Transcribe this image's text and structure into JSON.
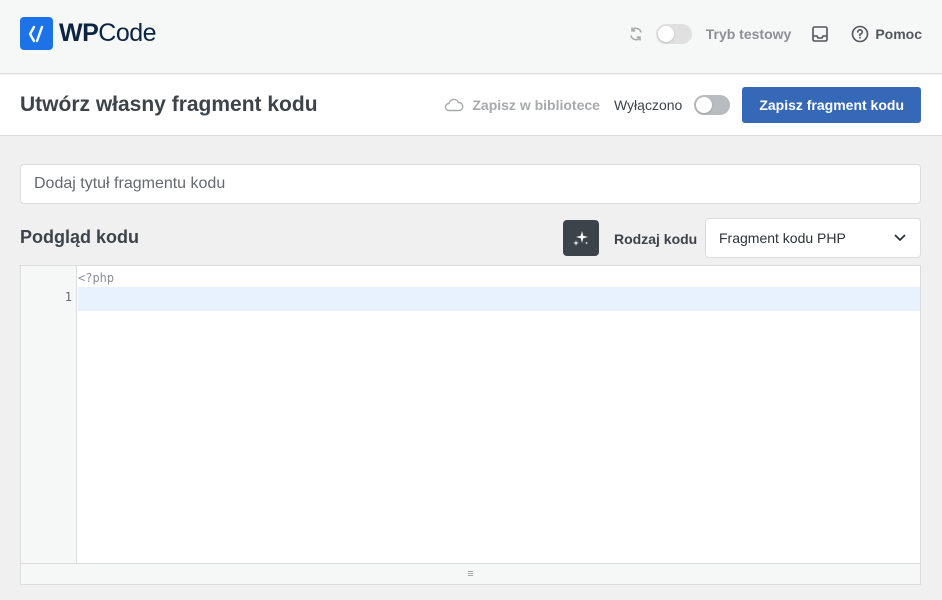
{
  "header": {
    "logo": {
      "bold": "WP",
      "light": "Code"
    },
    "test_mode_label": "Tryb testowy",
    "help_label": "Pomoc",
    "icons": [
      "sync-icon",
      "inbox-icon",
      "help-circle-icon"
    ]
  },
  "titlebar": {
    "title": "Utwórz własny fragment kodu",
    "library_link": "Zapisz w bibliotece",
    "status_label": "Wyłączono",
    "save_button": "Zapisz fragment kodu"
  },
  "form": {
    "title_placeholder": "Dodaj tytuł fragmentu kodu",
    "title_value": "",
    "preview_title": "Podgląd kodu",
    "code_type_label": "Rodzaj kodu",
    "code_type_value": "Fragment kodu PHP"
  },
  "editor": {
    "prefix": "<?php",
    "line_numbers": [
      "1"
    ],
    "resize_glyph": "≡"
  },
  "colors": {
    "primary": "#3568b7",
    "logo_blue": "#1d72e8",
    "active_line": "#e8f2fe"
  }
}
